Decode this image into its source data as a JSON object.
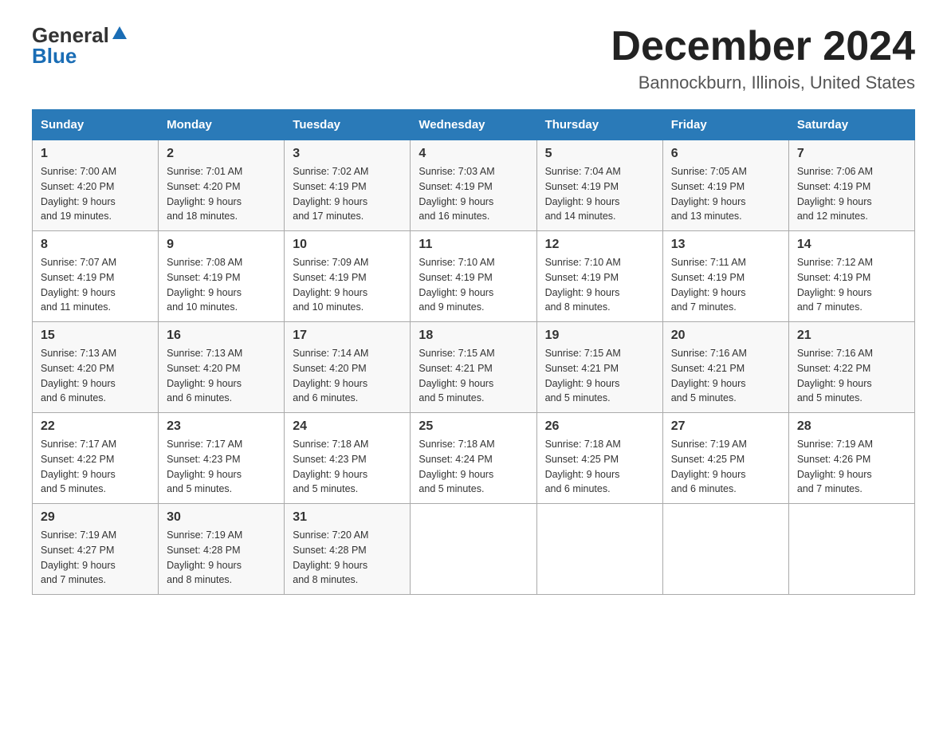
{
  "logo": {
    "general": "General",
    "blue": "Blue"
  },
  "header": {
    "title": "December 2024",
    "subtitle": "Bannockburn, Illinois, United States"
  },
  "weekdays": [
    "Sunday",
    "Monday",
    "Tuesday",
    "Wednesday",
    "Thursday",
    "Friday",
    "Saturday"
  ],
  "weeks": [
    [
      {
        "day": "1",
        "sunrise": "7:00 AM",
        "sunset": "4:20 PM",
        "daylight": "9 hours and 19 minutes."
      },
      {
        "day": "2",
        "sunrise": "7:01 AM",
        "sunset": "4:20 PM",
        "daylight": "9 hours and 18 minutes."
      },
      {
        "day": "3",
        "sunrise": "7:02 AM",
        "sunset": "4:19 PM",
        "daylight": "9 hours and 17 minutes."
      },
      {
        "day": "4",
        "sunrise": "7:03 AM",
        "sunset": "4:19 PM",
        "daylight": "9 hours and 16 minutes."
      },
      {
        "day": "5",
        "sunrise": "7:04 AM",
        "sunset": "4:19 PM",
        "daylight": "9 hours and 14 minutes."
      },
      {
        "day": "6",
        "sunrise": "7:05 AM",
        "sunset": "4:19 PM",
        "daylight": "9 hours and 13 minutes."
      },
      {
        "day": "7",
        "sunrise": "7:06 AM",
        "sunset": "4:19 PM",
        "daylight": "9 hours and 12 minutes."
      }
    ],
    [
      {
        "day": "8",
        "sunrise": "7:07 AM",
        "sunset": "4:19 PM",
        "daylight": "9 hours and 11 minutes."
      },
      {
        "day": "9",
        "sunrise": "7:08 AM",
        "sunset": "4:19 PM",
        "daylight": "9 hours and 10 minutes."
      },
      {
        "day": "10",
        "sunrise": "7:09 AM",
        "sunset": "4:19 PM",
        "daylight": "9 hours and 10 minutes."
      },
      {
        "day": "11",
        "sunrise": "7:10 AM",
        "sunset": "4:19 PM",
        "daylight": "9 hours and 9 minutes."
      },
      {
        "day": "12",
        "sunrise": "7:10 AM",
        "sunset": "4:19 PM",
        "daylight": "9 hours and 8 minutes."
      },
      {
        "day": "13",
        "sunrise": "7:11 AM",
        "sunset": "4:19 PM",
        "daylight": "9 hours and 7 minutes."
      },
      {
        "day": "14",
        "sunrise": "7:12 AM",
        "sunset": "4:19 PM",
        "daylight": "9 hours and 7 minutes."
      }
    ],
    [
      {
        "day": "15",
        "sunrise": "7:13 AM",
        "sunset": "4:20 PM",
        "daylight": "9 hours and 6 minutes."
      },
      {
        "day": "16",
        "sunrise": "7:13 AM",
        "sunset": "4:20 PM",
        "daylight": "9 hours and 6 minutes."
      },
      {
        "day": "17",
        "sunrise": "7:14 AM",
        "sunset": "4:20 PM",
        "daylight": "9 hours and 6 minutes."
      },
      {
        "day": "18",
        "sunrise": "7:15 AM",
        "sunset": "4:21 PM",
        "daylight": "9 hours and 5 minutes."
      },
      {
        "day": "19",
        "sunrise": "7:15 AM",
        "sunset": "4:21 PM",
        "daylight": "9 hours and 5 minutes."
      },
      {
        "day": "20",
        "sunrise": "7:16 AM",
        "sunset": "4:21 PM",
        "daylight": "9 hours and 5 minutes."
      },
      {
        "day": "21",
        "sunrise": "7:16 AM",
        "sunset": "4:22 PM",
        "daylight": "9 hours and 5 minutes."
      }
    ],
    [
      {
        "day": "22",
        "sunrise": "7:17 AM",
        "sunset": "4:22 PM",
        "daylight": "9 hours and 5 minutes."
      },
      {
        "day": "23",
        "sunrise": "7:17 AM",
        "sunset": "4:23 PM",
        "daylight": "9 hours and 5 minutes."
      },
      {
        "day": "24",
        "sunrise": "7:18 AM",
        "sunset": "4:23 PM",
        "daylight": "9 hours and 5 minutes."
      },
      {
        "day": "25",
        "sunrise": "7:18 AM",
        "sunset": "4:24 PM",
        "daylight": "9 hours and 5 minutes."
      },
      {
        "day": "26",
        "sunrise": "7:18 AM",
        "sunset": "4:25 PM",
        "daylight": "9 hours and 6 minutes."
      },
      {
        "day": "27",
        "sunrise": "7:19 AM",
        "sunset": "4:25 PM",
        "daylight": "9 hours and 6 minutes."
      },
      {
        "day": "28",
        "sunrise": "7:19 AM",
        "sunset": "4:26 PM",
        "daylight": "9 hours and 7 minutes."
      }
    ],
    [
      {
        "day": "29",
        "sunrise": "7:19 AM",
        "sunset": "4:27 PM",
        "daylight": "9 hours and 7 minutes."
      },
      {
        "day": "30",
        "sunrise": "7:19 AM",
        "sunset": "4:28 PM",
        "daylight": "9 hours and 8 minutes."
      },
      {
        "day": "31",
        "sunrise": "7:20 AM",
        "sunset": "4:28 PM",
        "daylight": "9 hours and 8 minutes."
      },
      null,
      null,
      null,
      null
    ]
  ]
}
